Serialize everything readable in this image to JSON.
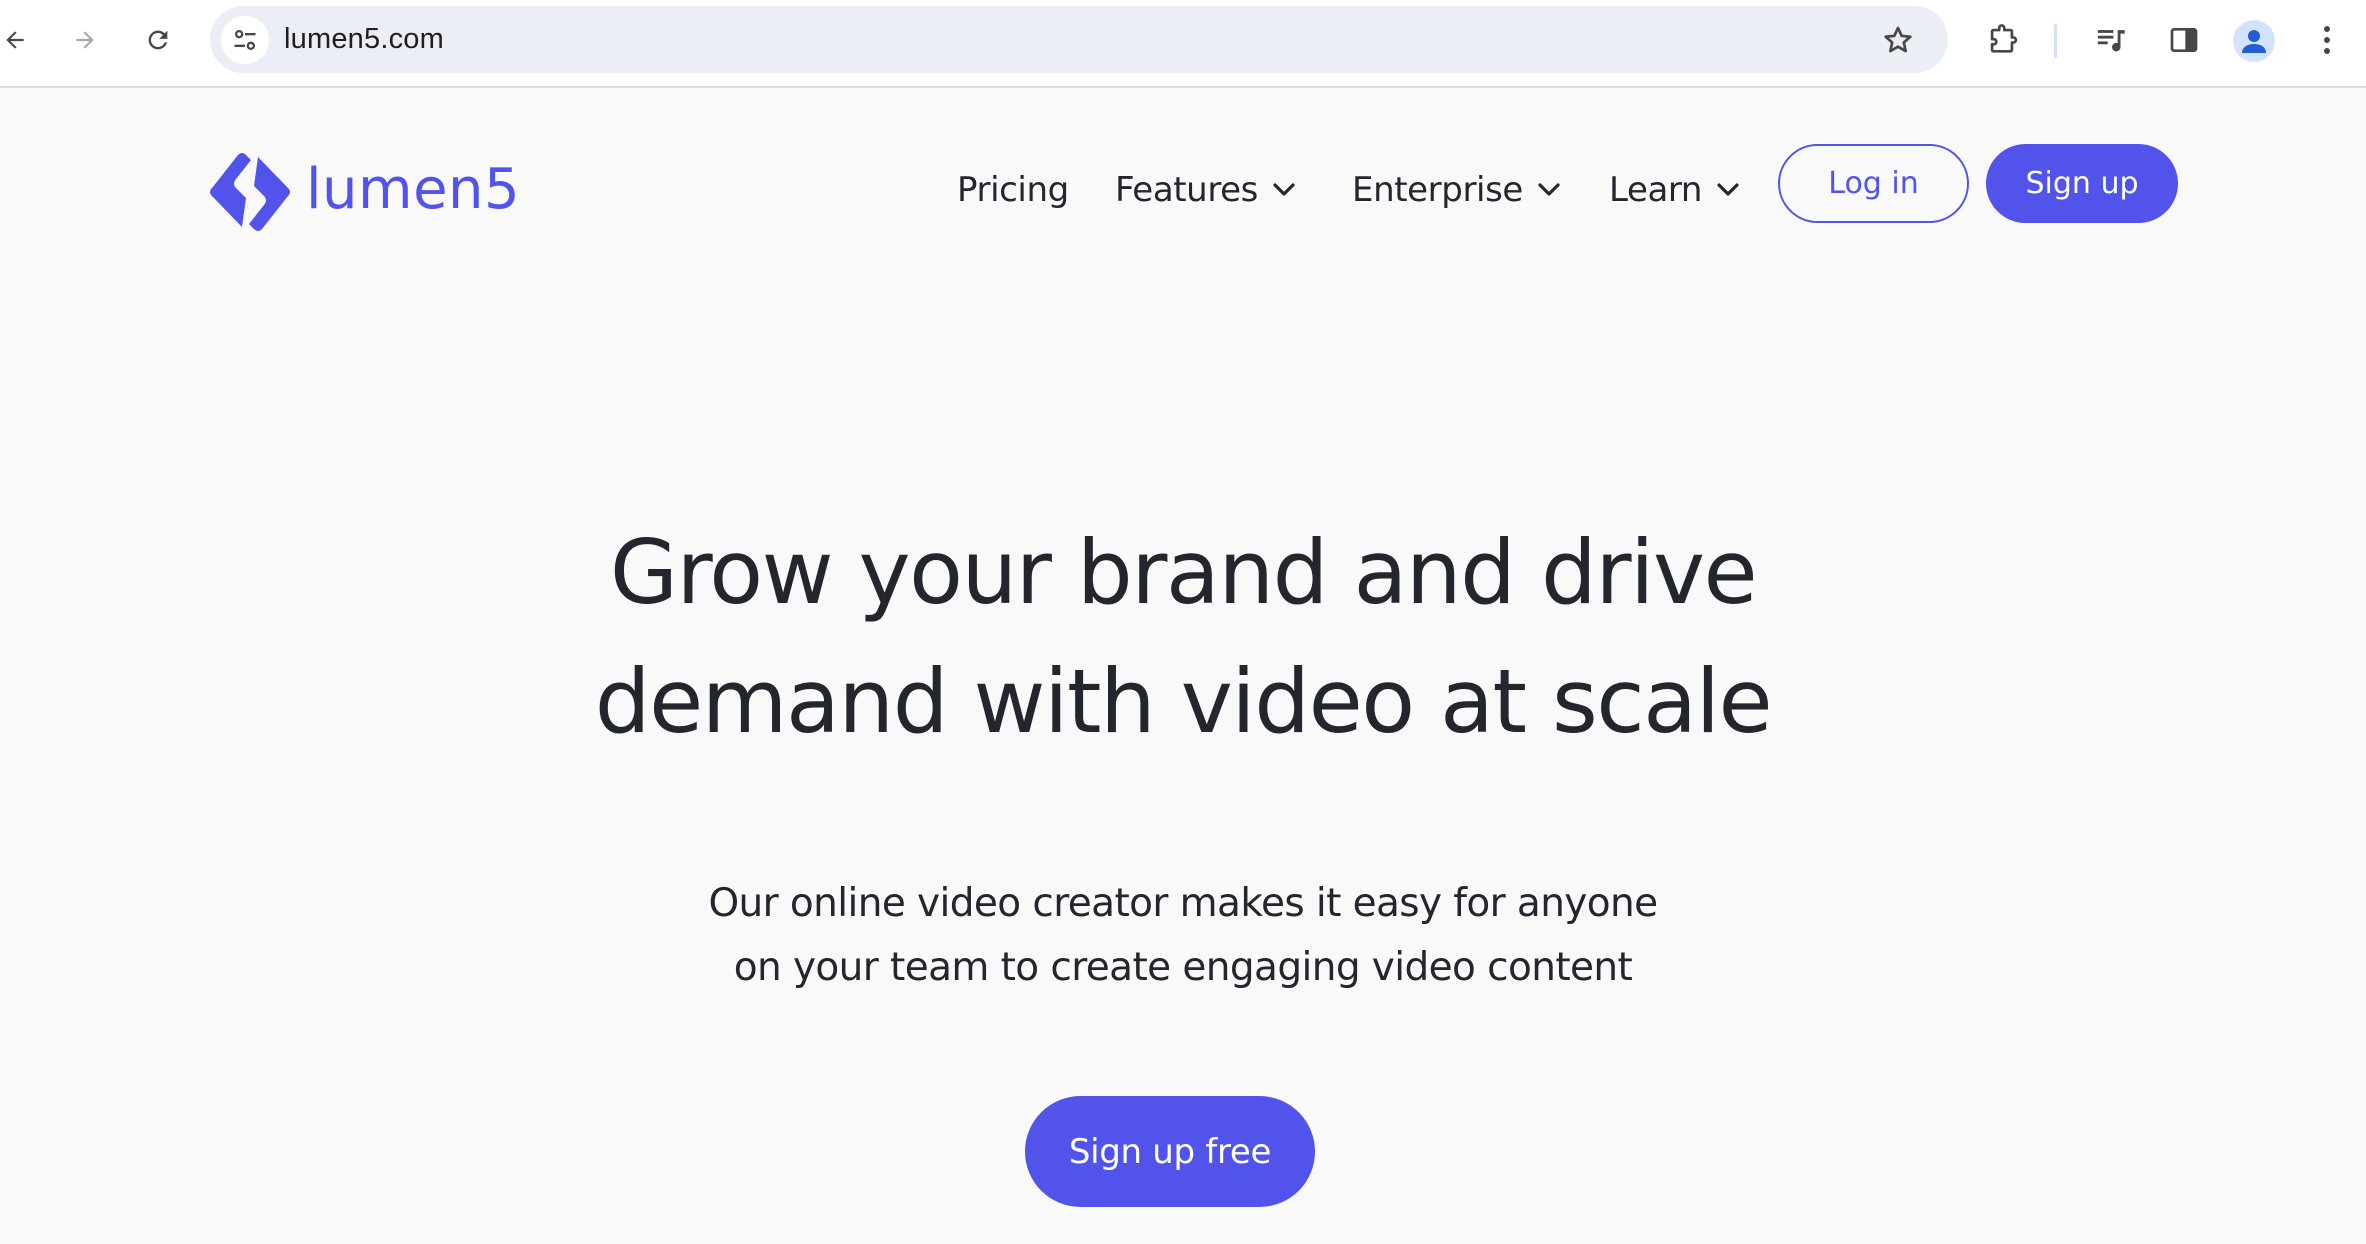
{
  "browser": {
    "url": "lumen5.com",
    "icons": {
      "back": "arrow-left-icon",
      "forward": "arrow-right-icon",
      "reload": "reload-icon",
      "site_info": "tune-icon",
      "bookmark": "star-icon",
      "extensions": "puzzle-icon",
      "media": "media-queue-icon",
      "side_panel": "side-panel-icon",
      "profile": "avatar-icon",
      "menu": "kebab-menu-icon"
    }
  },
  "site": {
    "brand": {
      "name": "lumen5",
      "color": "#5153eb"
    },
    "nav": {
      "items": [
        {
          "label": "Pricing",
          "has_dropdown": false
        },
        {
          "label": "Features",
          "has_dropdown": true
        },
        {
          "label": "Enterprise",
          "has_dropdown": true
        },
        {
          "label": "Learn",
          "has_dropdown": true
        }
      ],
      "login_label": "Log in",
      "signup_label": "Sign up"
    },
    "hero": {
      "title_lines": [
        "Grow your brand and drive",
        "demand with video at scale"
      ],
      "subtitle_lines": [
        "Our online video creator makes it easy for anyone",
        "on your team to create engaging video content"
      ],
      "cta_label": "Sign up free"
    },
    "colors": {
      "accent": "#5153eb",
      "text": "#24262d",
      "background": "#f9f9fa"
    }
  }
}
